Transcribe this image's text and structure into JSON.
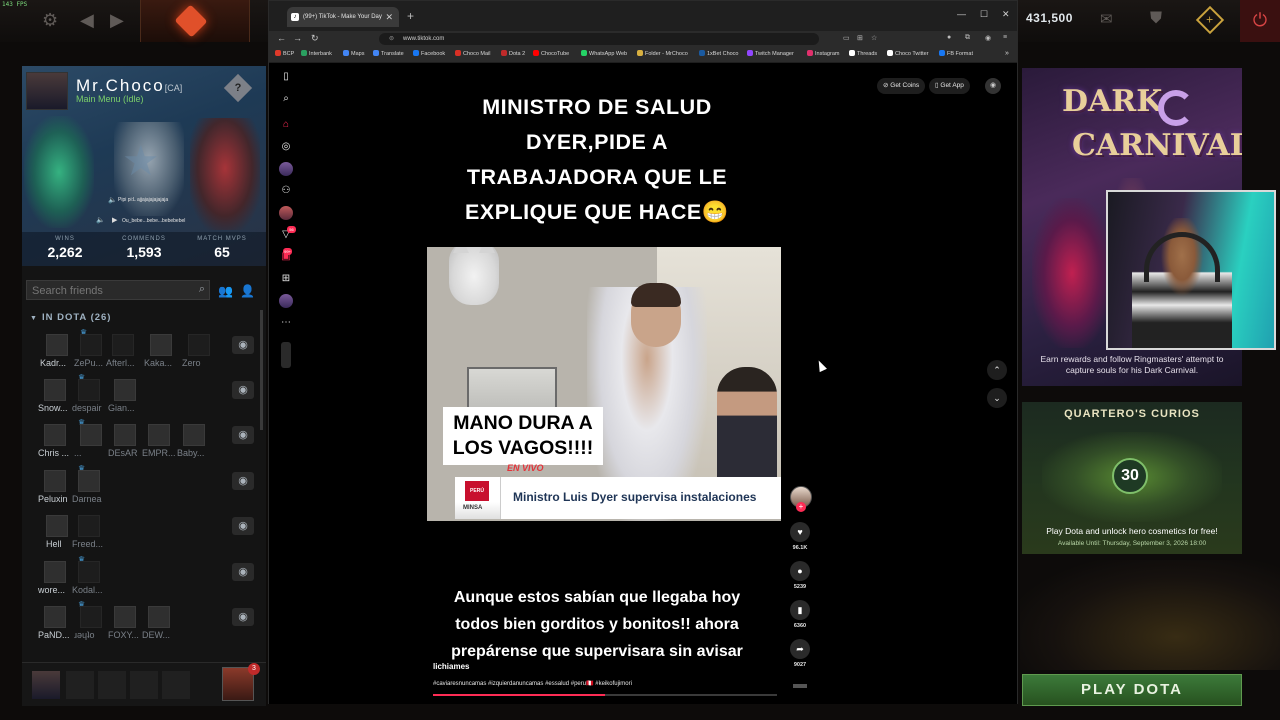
{
  "dota": {
    "fps": "143 FPS",
    "shards": "431,500",
    "profile": {
      "name": "Mr.Choco",
      "tag": "[CA]",
      "status": "Main Menu (Idle)",
      "voice_lines": [
        "Pipi pi:L ajjajajajajajaja",
        "Ou_bebe...bebe...bebebebel"
      ],
      "stats": [
        {
          "label": "WINS",
          "value": "2,262"
        },
        {
          "label": "COMMENDS",
          "value": "1,593"
        },
        {
          "label": "MATCH MVPS",
          "value": "65"
        }
      ]
    },
    "search_placeholder": "Search friends",
    "group_label": "IN DOTA",
    "group_count": "(26)",
    "friend_rows": [
      {
        "names": [
          "Kadr...",
          "ZePu...",
          "Afterl...",
          "Kaka...",
          "Zero"
        ]
      },
      {
        "names": [
          "Snow...",
          "despair",
          "Gian..."
        ]
      },
      {
        "names": [
          "Chris ...",
          "...",
          "DEsAR",
          "EMPR...",
          "Baby..."
        ]
      },
      {
        "names": [
          "Peluxin",
          "Darnea"
        ]
      },
      {
        "names": [
          "Hell",
          "Freed..."
        ]
      },
      {
        "names": [
          "wore...",
          "Kodal..."
        ]
      },
      {
        "names": [
          "PaND...",
          "ɹǝɥʇo",
          "FOXY...",
          "DEW..."
        ]
      }
    ],
    "party_count": "3",
    "carnival": {
      "title_line1": "DARK",
      "title_line2": "CARNIVAL",
      "description": "Earn rewards and follow Ringmasters' attempt to capture souls for his Dark Carnival."
    },
    "curios": {
      "title": "QUARTERO'S CURIOS",
      "number": "30",
      "description": "Play Dota and unlock hero cosmetics for free!",
      "available": "Available Until: Thursday, September 3, 2026 18:00"
    },
    "play_button": "PLAY DOTA"
  },
  "browser": {
    "tab_title": "(99+) TikTok - Make Your Day",
    "url": "www.tiktok.com",
    "bookmarks": [
      "BCP",
      "Interbank",
      "Maps",
      "Translate",
      "Facebook",
      "Choco Mail",
      "Dota 2",
      "ChocoTube",
      "WhatsApp Web",
      "Folder - MrChoco",
      "1xBet Choco",
      "Twitch Manager",
      "Instagram",
      "Threads",
      "Choco Twitter",
      "FB Format"
    ],
    "bookmark_colors": [
      "#e03a2a",
      "#2aa060",
      "#4285f4",
      "#4285f4",
      "#1877f2",
      "#d93025",
      "#c02a2a",
      "#ff0000",
      "#25d366",
      "#d8b040",
      "#1a5aa0",
      "#9146ff",
      "#e1306c",
      "#ffffff",
      "#ffffff",
      "#1877f2"
    ]
  },
  "tiktok": {
    "get_coins": "Get Coins",
    "get_app": "Get App",
    "sidebar_badge_1": "56",
    "sidebar_badge_2": "99+",
    "video_title_lines": [
      "MINISTRO DE SALUD",
      "DYER,PIDE A",
      "TRABAJADORA QUE LE",
      "EXPLIQUE QUE HACE😁"
    ],
    "meme_text_lines": [
      "MANO DURA A",
      "LOS VAGOS!!!!"
    ],
    "en_vivo": "EN VIVO",
    "peru": "PERÚ",
    "minsa": "MINSA",
    "chyron": "Ministro Luis Dyer supervisa instalaciones",
    "caption_lines": [
      "Aunque estos sabían que llegaba hoy",
      "todos bien gorditos y bonitos!! ahora",
      "prepárense que supervisara sin avisar"
    ],
    "author": "lichiames",
    "hashtags": "#caviaresnuncamas #izquierdanuncamas #essalud #peru🇵🇪 #keikofujimori",
    "progress": 0.5,
    "likes": "96.1K",
    "comments": "5239",
    "saves": "6360",
    "shares": "9027",
    "accent": "#fe2c55"
  }
}
